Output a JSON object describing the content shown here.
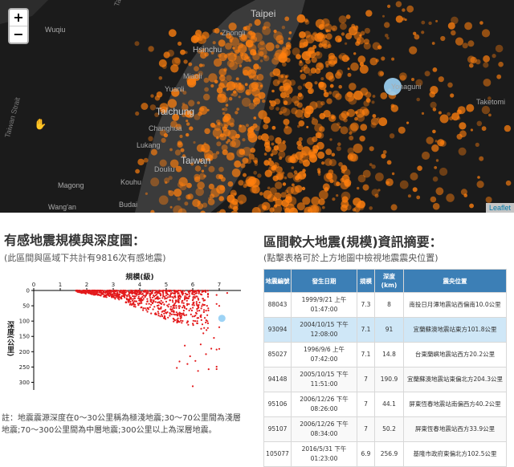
{
  "map": {
    "zoom_in": "+",
    "zoom_out": "−",
    "attribution": "Leaflet",
    "labels": [
      {
        "text": "Taipei",
        "cls": "big"
      },
      {
        "text": "Zhongli",
        "cls": ""
      },
      {
        "text": "Hsinchu",
        "cls": "mid"
      },
      {
        "text": "Miaoli",
        "cls": ""
      },
      {
        "text": "Yuanli",
        "cls": ""
      },
      {
        "text": "Taichung",
        "cls": "big"
      },
      {
        "text": "Changhua",
        "cls": ""
      },
      {
        "text": "Lukang",
        "cls": ""
      },
      {
        "text": "Douliu",
        "cls": ""
      },
      {
        "text": "Taiwan",
        "cls": "big"
      },
      {
        "text": "Wuqiu",
        "cls": ""
      },
      {
        "text": "Magong",
        "cls": ""
      },
      {
        "text": "Wang'an",
        "cls": ""
      },
      {
        "text": "Kouhu",
        "cls": ""
      },
      {
        "text": "Budai",
        "cls": ""
      },
      {
        "text": "Yonaguni",
        "cls": ""
      },
      {
        "text": "Taketomi",
        "cls": ""
      },
      {
        "text": "Taiwan Strait",
        "cls": "strait"
      },
      {
        "text": "Taiwan Strait",
        "cls": "strait"
      }
    ],
    "colors": {
      "quake": "#ff7f0e",
      "highlight": "#9dd3f5",
      "land": "#3b3b3b",
      "sea": "#1b1b1b"
    }
  },
  "left": {
    "title": "有感地震規模與深度圖：",
    "subtitle": "(此區間與區域下共計有9816次有感地震)",
    "note": "註：地震震源深度在0～30公里稱為極淺地震;30～70公里間為淺層地震;70～300公里間為中層地震;300公里以上為深層地震。"
  },
  "chart_data": {
    "type": "scatter",
    "title": "",
    "xlabel": "規模(級)",
    "ylabel": "深度(公里)",
    "xlim": [
      0,
      8
    ],
    "ylim": [
      0,
      325
    ],
    "xticks": [
      "0",
      "1",
      "2",
      "3",
      "4",
      "5",
      "6",
      "7",
      "8"
    ],
    "yticks": [
      "0",
      "50",
      "100",
      "150",
      "200",
      "250",
      "300"
    ],
    "point_color": "#e31a1c",
    "highlight": {
      "x": 7.1,
      "y": 91,
      "color": "#9dd3f5"
    },
    "sparse_points": [
      {
        "x": 5.9,
        "y": 215
      },
      {
        "x": 6.5,
        "y": 208
      },
      {
        "x": 6.7,
        "y": 190
      },
      {
        "x": 6.9,
        "y": 193
      },
      {
        "x": 5.5,
        "y": 232
      },
      {
        "x": 5.8,
        "y": 240
      },
      {
        "x": 6.1,
        "y": 230
      },
      {
        "x": 6.6,
        "y": 257
      },
      {
        "x": 6.9,
        "y": 249
      },
      {
        "x": 6.2,
        "y": 263
      },
      {
        "x": 5.4,
        "y": 253
      },
      {
        "x": 6.0,
        "y": 313
      },
      {
        "x": 5.7,
        "y": 180
      },
      {
        "x": 6.3,
        "y": 176
      },
      {
        "x": 6.8,
        "y": 155
      },
      {
        "x": 6.4,
        "y": 140
      },
      {
        "x": 7.0,
        "y": 120
      },
      {
        "x": 7.3,
        "y": 8
      },
      {
        "x": 6.9,
        "y": 14.8
      },
      {
        "x": 7.0,
        "y": 50.2
      },
      {
        "x": 6.9,
        "y": 44.1
      },
      {
        "x": 7.0,
        "y": 190.9
      },
      {
        "x": 6.9,
        "y": 256.9
      }
    ]
  },
  "right": {
    "title": "區間較大地震(規模)資訊摘要：",
    "subtitle": "(點擊表格可於上方地圖中檢視地震震央位置)",
    "headers": [
      "地震編號",
      "發生日期",
      "規模",
      "深度(km)",
      "震央位置"
    ],
    "rows": [
      {
        "id": "88043",
        "date": "1999/9/21 上午 01:47:00",
        "mag": "7.3",
        "depth": "8",
        "loc": "南投日月潭地震站西偏南10.0公里",
        "sel": false
      },
      {
        "id": "93094",
        "date": "2004/10/15 下午 12:08:00",
        "mag": "7.1",
        "depth": "91",
        "loc": "宜蘭蘇澳地震站東方101.8公里",
        "sel": true
      },
      {
        "id": "85027",
        "date": "1996/9/6 上午 07:42:00",
        "mag": "7.1",
        "depth": "14.8",
        "loc": "台東蘭嶼地震站西方20.2公里",
        "sel": false
      },
      {
        "id": "94148",
        "date": "2005/10/15 下午 11:51:00",
        "mag": "7",
        "depth": "190.9",
        "loc": "宜蘭蘇澳地震站東偏北方204.3公里",
        "sel": false
      },
      {
        "id": "95106",
        "date": "2006/12/26 下午 08:26:00",
        "mag": "7",
        "depth": "44.1",
        "loc": "屏東恆春地震站南偏西方40.2公里",
        "sel": false
      },
      {
        "id": "95107",
        "date": "2006/12/26 下午 08:34:00",
        "mag": "7",
        "depth": "50.2",
        "loc": "屏東恆春地震站西方33.9公里",
        "sel": false
      },
      {
        "id": "105077",
        "date": "2016/5/31 下午 01:23:00",
        "mag": "6.9",
        "depth": "256.9",
        "loc": "基隆市政府東偏北方102.5公里",
        "sel": false
      }
    ]
  }
}
